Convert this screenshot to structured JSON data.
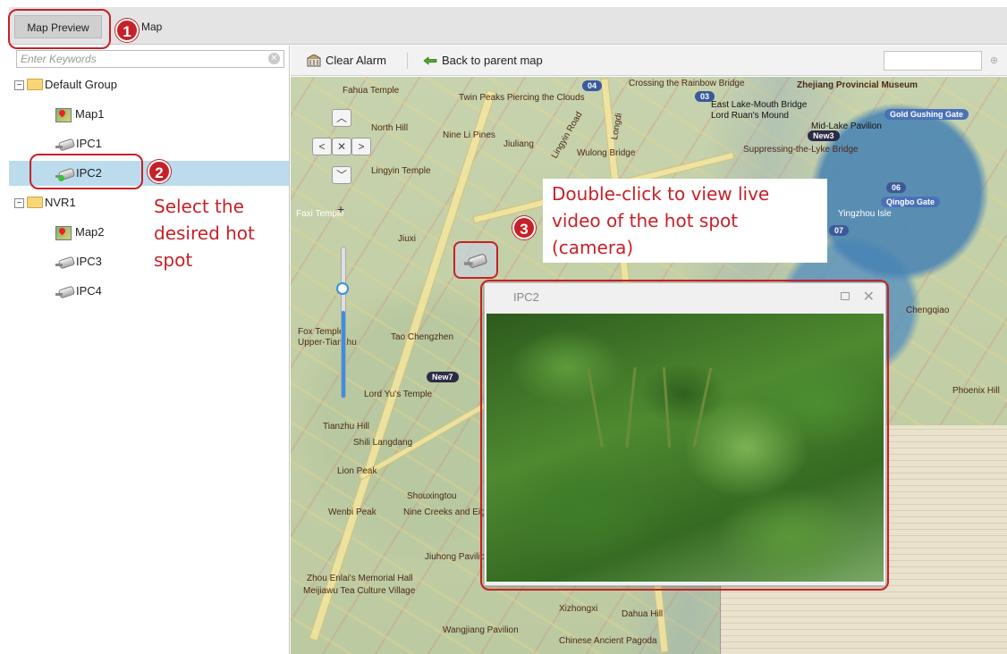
{
  "tabs": {
    "preview_label": "Map Preview",
    "map_label": "Map"
  },
  "tree": {
    "search_placeholder": "Enter Keywords",
    "items": [
      {
        "label": "Default Group"
      },
      {
        "label": "Map1"
      },
      {
        "label": "IPC1"
      },
      {
        "label": "IPC2"
      },
      {
        "label": "NVR1"
      },
      {
        "label": "Map2"
      },
      {
        "label": "IPC3"
      },
      {
        "label": "IPC4"
      }
    ]
  },
  "toolbar": {
    "clear_alarm_label": "Clear Alarm",
    "back_label": "Back to parent map"
  },
  "map": {
    "labels": [
      "Fahua Temple",
      "Twin Peaks Piercing the Clouds",
      "North Hill",
      "Nine Li Pines",
      "Lingyin Temple",
      "Jiuliang",
      "Wulong Bridge",
      "Lingyin Road",
      "Longdi",
      "Crossing the Rainbow Bridge",
      "Zhejiang Provincial Museum",
      "East Lake-Mouth Bridge",
      "Lord Ruan's Mound",
      "Mid-Lake Pavilion",
      "Suppressing-the-Lyke Bridge",
      "Gold Gushing Gate",
      "Qingbo Gate",
      "Yingzhou Isle",
      "Faxi Temple",
      "Jiuxi",
      "Fox Temple",
      "Upper-Tianzhu",
      "Tao Chengzhen",
      "Lord Yu's Temple",
      "Tianzhu Hill",
      "Shili Langdang",
      "Lion Peak",
      "Shouxingtou",
      "Wenbi Peak",
      "Nine Creeks and Eighteen Gullies",
      "Jiuhong Pavilion",
      "Zhou Enlai's Memorial Hall",
      "Meijiawu Tea Culture Village",
      "Xizhongxi",
      "Dahua Hill",
      "Wangjiang Pavilion",
      "Chinese Ancient Pagoda",
      "Chengqiao",
      "Phoenix Hill"
    ],
    "badges": [
      "04",
      "03",
      "New3",
      "06",
      "07",
      "New7"
    ]
  },
  "video": {
    "title": "IPC2"
  },
  "annotations": {
    "step1": "1",
    "step2": "2",
    "step3": "3",
    "step2_text": [
      "Select the",
      "desired hot",
      "spot"
    ],
    "step3_text": [
      "Double-click to view live",
      "video of the hot spot",
      "(camera)"
    ]
  },
  "colors": {
    "annotation": "#c62128",
    "selection": "#bcdcee",
    "online": "#37c23b",
    "zoom": "#3b8fe0"
  }
}
